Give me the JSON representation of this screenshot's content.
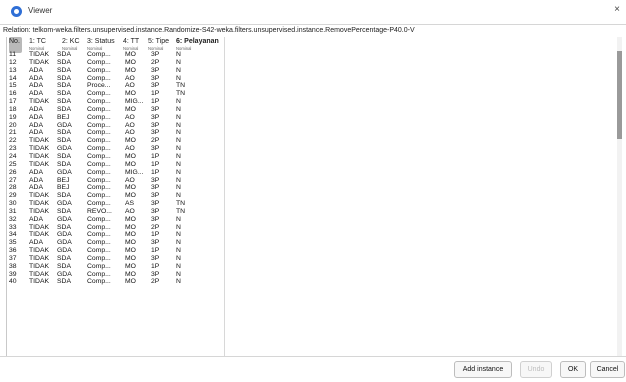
{
  "window": {
    "title": "Viewer",
    "close_glyph": "×"
  },
  "relation": "Relation: telkom-weka.filters.unsupervised.instance.Randomize-S42-weka.filters.unsupervised.instance.RemovePercentage-P40.0-V",
  "columns": [
    {
      "label": "No.",
      "type": ""
    },
    {
      "label": "1: TC",
      "type": "Nominal"
    },
    {
      "label": "2: KC",
      "type": "Nominal"
    },
    {
      "label": "3: Status",
      "type": "Nominal"
    },
    {
      "label": "4: TT",
      "type": "Nominal"
    },
    {
      "label": "5: Tipe",
      "type": "Nominal"
    },
    {
      "label": "6: Pelayanan",
      "type": "Nominal"
    }
  ],
  "rows": [
    [
      "11",
      "TIDAK",
      "SDA",
      "Comp...",
      "MO",
      "3P",
      "N"
    ],
    [
      "12",
      "TIDAK",
      "SDA",
      "Comp...",
      "MO",
      "2P",
      "N"
    ],
    [
      "13",
      "ADA",
      "SDA",
      "Comp...",
      "MO",
      "3P",
      "N"
    ],
    [
      "14",
      "ADA",
      "SDA",
      "Comp...",
      "AO",
      "3P",
      "N"
    ],
    [
      "15",
      "ADA",
      "SDA",
      "Proce...",
      "AO",
      "3P",
      "TN"
    ],
    [
      "16",
      "ADA",
      "SDA",
      "Comp...",
      "MO",
      "1P",
      "TN"
    ],
    [
      "17",
      "TIDAK",
      "SDA",
      "Comp...",
      "MIG...",
      "1P",
      "N"
    ],
    [
      "18",
      "ADA",
      "SDA",
      "Comp...",
      "MO",
      "3P",
      "N"
    ],
    [
      "19",
      "ADA",
      "BEJ",
      "Comp...",
      "AO",
      "3P",
      "N"
    ],
    [
      "20",
      "ADA",
      "GDA",
      "Comp...",
      "AO",
      "3P",
      "N"
    ],
    [
      "21",
      "ADA",
      "SDA",
      "Comp...",
      "AO",
      "3P",
      "N"
    ],
    [
      "22",
      "TIDAK",
      "SDA",
      "Comp...",
      "MO",
      "2P",
      "N"
    ],
    [
      "23",
      "TIDAK",
      "GDA",
      "Comp...",
      "AO",
      "3P",
      "N"
    ],
    [
      "24",
      "TIDAK",
      "SDA",
      "Comp...",
      "MO",
      "1P",
      "N"
    ],
    [
      "25",
      "TIDAK",
      "SDA",
      "Comp...",
      "MO",
      "1P",
      "N"
    ],
    [
      "26",
      "ADA",
      "GDA",
      "Comp...",
      "MIG...",
      "1P",
      "N"
    ],
    [
      "27",
      "ADA",
      "BEJ",
      "Comp...",
      "AO",
      "3P",
      "N"
    ],
    [
      "28",
      "ADA",
      "BEJ",
      "Comp...",
      "MO",
      "3P",
      "N"
    ],
    [
      "29",
      "TIDAK",
      "SDA",
      "Comp...",
      "MO",
      "3P",
      "N"
    ],
    [
      "30",
      "TIDAK",
      "GDA",
      "Comp...",
      "AS",
      "3P",
      "TN"
    ],
    [
      "31",
      "TIDAK",
      "SDA",
      "REVO...",
      "AO",
      "3P",
      "TN"
    ],
    [
      "32",
      "ADA",
      "GDA",
      "Comp...",
      "MO",
      "3P",
      "N"
    ],
    [
      "33",
      "TIDAK",
      "SDA",
      "Comp...",
      "MO",
      "2P",
      "N"
    ],
    [
      "34",
      "TIDAK",
      "GDA",
      "Comp...",
      "MO",
      "1P",
      "N"
    ],
    [
      "35",
      "ADA",
      "GDA",
      "Comp...",
      "MO",
      "3P",
      "N"
    ],
    [
      "36",
      "TIDAK",
      "GDA",
      "Comp...",
      "MO",
      "1P",
      "N"
    ],
    [
      "37",
      "TIDAK",
      "SDA",
      "Comp...",
      "MO",
      "3P",
      "N"
    ],
    [
      "38",
      "TIDAK",
      "SDA",
      "Comp...",
      "MO",
      "1P",
      "N"
    ],
    [
      "39",
      "TIDAK",
      "GDA",
      "Comp...",
      "MO",
      "3P",
      "N"
    ],
    [
      "40",
      "TIDAK",
      "SDA",
      "Comp...",
      "MO",
      "2P",
      "N"
    ]
  ],
  "buttons": {
    "add_instance": "Add instance",
    "undo": "Undo",
    "ok": "OK",
    "cancel": "Cancel"
  },
  "colors": {
    "accent": "#2f6fd6",
    "scroll_thumb": "#9a9a9a",
    "header_highlight": "#b9b9b9"
  }
}
